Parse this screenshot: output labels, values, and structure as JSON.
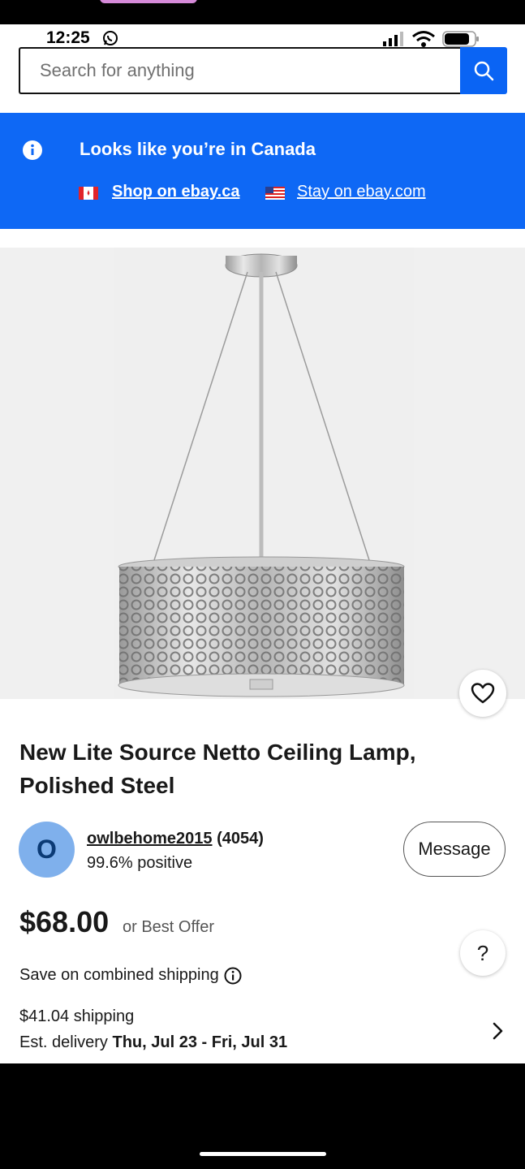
{
  "status_bar": {
    "time": "12:25",
    "icons": [
      "whatsapp-icon",
      "signal-icon",
      "wifi-icon",
      "battery-icon"
    ]
  },
  "search": {
    "placeholder": "Search for anything",
    "button_icon": "search-icon"
  },
  "location_banner": {
    "message": "Looks like you’re in Canada",
    "primary_link": "Shop on ebay.ca",
    "secondary_link": "Stay on ebay.com",
    "background_color": "#0e68f5"
  },
  "product": {
    "image_alt_icon": "pendant-lamp-image",
    "title": "New Lite Source Netto Ceiling Lamp, Polished Steel",
    "price": "$68.00",
    "price_suffix": "or Best Offer"
  },
  "seller": {
    "avatar_letter": "O",
    "username": "owlbehome2015",
    "score": "(4054)",
    "feedback": "99.6% positive",
    "message_label": "Message"
  },
  "shipping": {
    "combined": "Save on combined shipping",
    "cost": "$41.04 shipping",
    "delivery_prefix": "Est. delivery",
    "delivery_dates": "Thu, Jul 23 - Fri, Jul 31"
  },
  "help_label": "?"
}
